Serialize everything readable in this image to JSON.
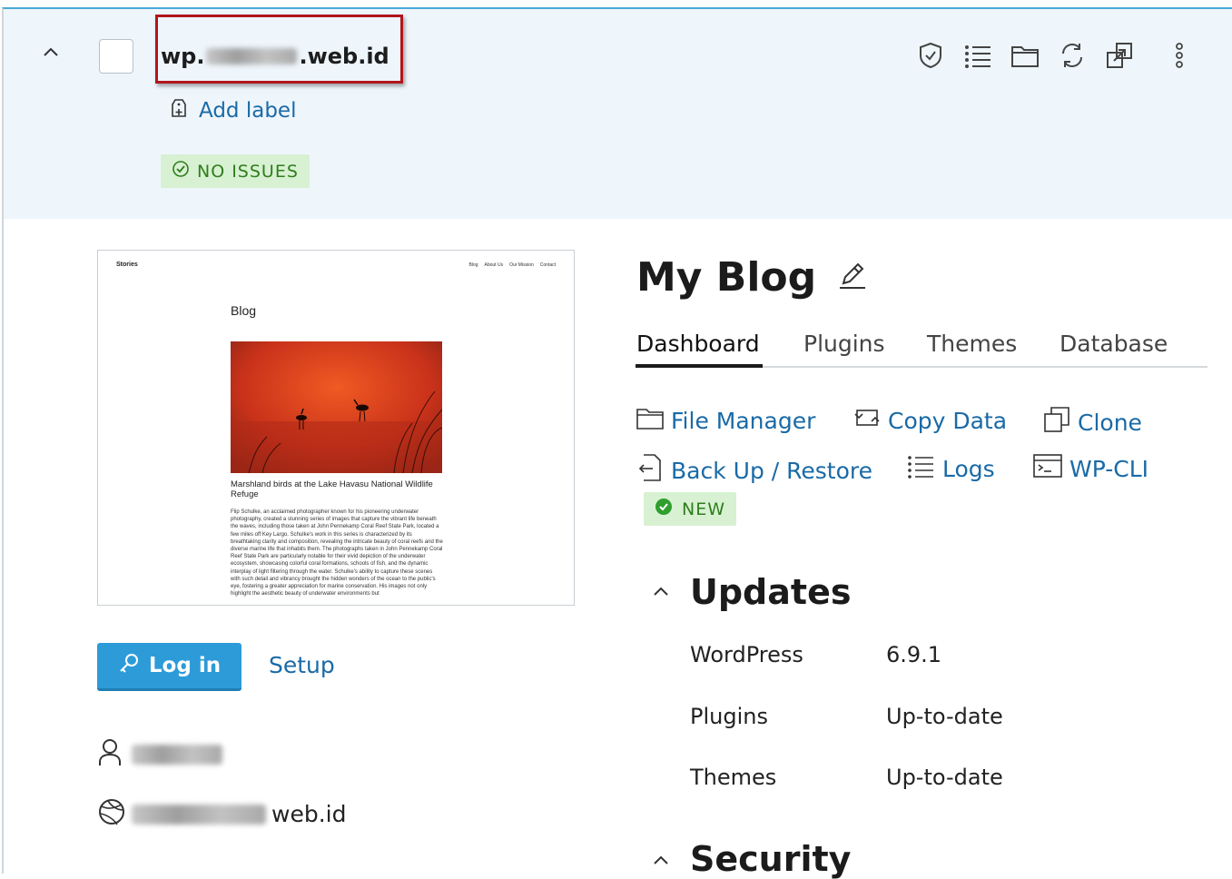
{
  "header": {
    "domain_prefix": "wp.",
    "domain_suffix": ".web.id",
    "add_label": "Add label",
    "status_badge": "NO ISSUES"
  },
  "site": {
    "title": "My Blog",
    "tabs": [
      "Dashboard",
      "Plugins",
      "Themes",
      "Database"
    ],
    "actions": [
      {
        "label": "File Manager",
        "icon": "folder-icon"
      },
      {
        "label": "Copy Data",
        "icon": "copy-data-icon"
      },
      {
        "label": "Clone",
        "icon": "clone-icon"
      },
      {
        "label": "Back Up / Restore",
        "icon": "backup-icon"
      },
      {
        "label": "Logs",
        "icon": "list-icon"
      },
      {
        "label": "WP-CLI",
        "icon": "terminal-icon"
      }
    ],
    "new_badge": "NEW"
  },
  "preview": {
    "site_name": "Stories",
    "nav": [
      "Blog",
      "About Us",
      "Our Mission",
      "Contact"
    ],
    "heading": "Blog",
    "caption": "Marshland birds at the Lake Havasu National Wildlife Refuge",
    "body": "Flip Schulke, an acclaimed photographer known for his pioneering underwater photography, created a stunning series of images that capture the vibrant life beneath the waves, including those taken at John Pennekamp Coral Reef State Park, located a few miles off Key Largo. Schulke's work in this series is characterized by its breathtaking clarity and composition, revealing the intricate beauty of coral reefs and the diverse marine life that inhabits them. The photographs taken in John Pennekamp Coral Reef State Park are particularly notable for their vivid depiction of the underwater ecosystem, showcasing colorful coral formations, schools of fish, and the dynamic interplay of light filtering through the water. Schulke's ability to capture these scenes with such detail and vibrancy brought the hidden wonders of the ocean to the public's eye, fostering a greater appreciation for marine conservation. His images not only highlight the aesthetic beauty of underwater environments but"
  },
  "left": {
    "login_label": "Log in",
    "setup_label": "Setup",
    "url_suffix": "web.id"
  },
  "updates": {
    "title": "Updates",
    "rows": [
      {
        "name": "WordPress",
        "value": "6.9.1"
      },
      {
        "name": "Plugins",
        "value": "Up-to-date"
      },
      {
        "name": "Themes",
        "value": "Up-to-date"
      }
    ]
  },
  "security": {
    "title": "Security"
  },
  "colors": {
    "accent": "#2d9bd8",
    "link": "#1a6aa6",
    "success": "#2f7d1d",
    "header_bg": "#eef6fc",
    "highlight": "#b1161c"
  }
}
